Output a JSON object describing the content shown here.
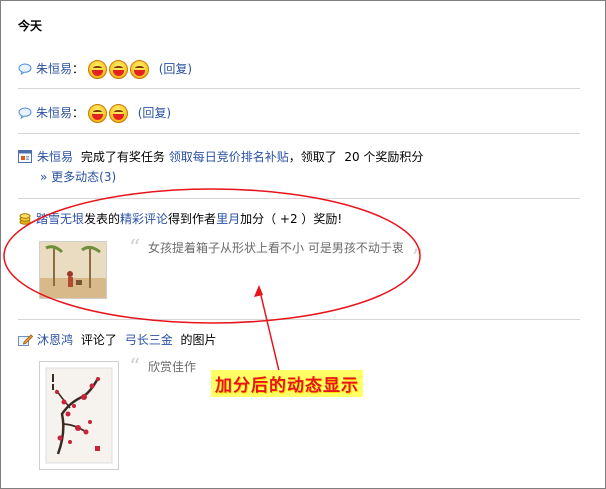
{
  "section_title": "今天",
  "feed": [
    {
      "user": "朱恒易",
      "colon": "：",
      "emoji_count": 3,
      "reply_label": "(回复)"
    },
    {
      "user": "朱恒易",
      "colon": "：",
      "emoji_count": 2,
      "reply_label": "(回复)"
    },
    {
      "user": "朱恒易",
      "text_before": "完成了有奖任务",
      "task_link": "领取每日竞价排名补贴",
      "text_after": "，领取了  20 个奖励积分",
      "more_link": "» 更多动态(3)"
    },
    {
      "user": "踏雪无垠",
      "text_1": "发表的",
      "post_link": "精彩评论",
      "text_2": "得到作者",
      "author_link": "里月",
      "text_3": "加分（ +2 ）奖励!",
      "quote": "女孩提着箱子从形状上看不小  可是男孩不动于衷"
    },
    {
      "user": "沐恩鸿",
      "text_1": "评论了",
      "target_link": "弓长三金",
      "text_2": "的图片",
      "quote": "欣赏佳作"
    }
  ],
  "annotation": {
    "callout_text": "加分后的动态显示",
    "ellipse_color": "#e8141c",
    "callout_text_color": "#e8141c",
    "callout_bg": "#ffff66"
  }
}
